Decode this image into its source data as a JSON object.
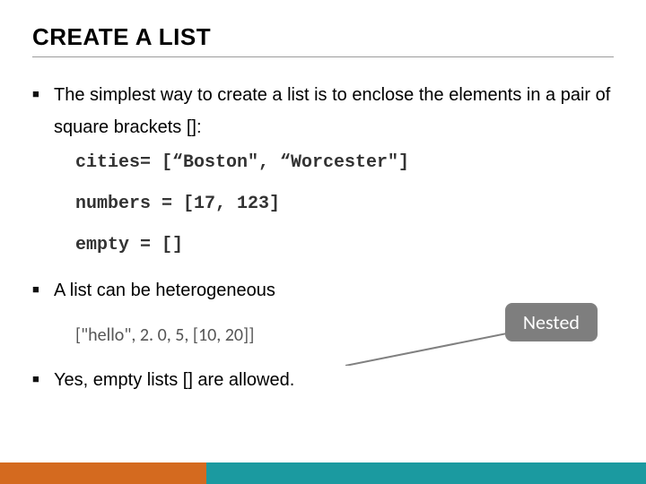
{
  "title": "CREATE A LIST",
  "bullets": {
    "b1": "The simplest way to create a list is to enclose the elements in a pair of square brackets []:",
    "b2": "A list can be heterogeneous",
    "b3": "Yes, empty lists [] are allowed."
  },
  "code": {
    "line1": "cities= [“Boston\", “Worcester\"]",
    "line2": "numbers = [17, 123]",
    "line3": "empty = []"
  },
  "example": "[\"hello\", 2. 0, 5, [10, 20]]",
  "callout": "Nested",
  "colors": {
    "footer_orange": "#d46a1f",
    "footer_teal": "#1b9aa0",
    "callout_bg": "#7e7e7e"
  }
}
